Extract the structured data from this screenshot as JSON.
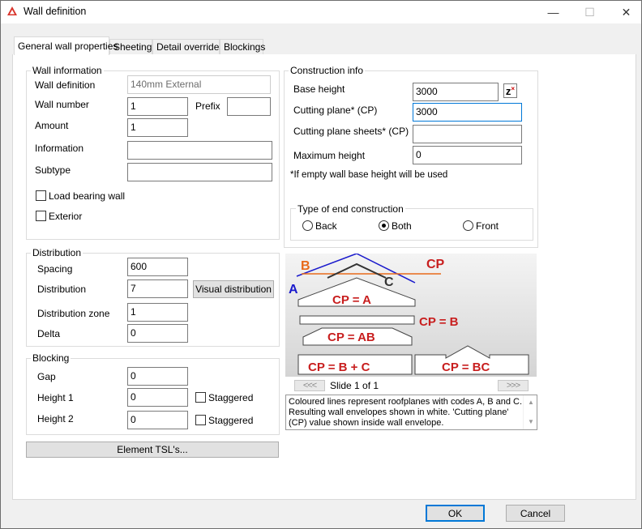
{
  "window": {
    "title": "Wall definition",
    "minimize": "—",
    "maximize": "☐",
    "close": "✕"
  },
  "tabs": [
    {
      "label": "General wall properties"
    },
    {
      "label": "Sheeting"
    },
    {
      "label": "Detail overrides"
    },
    {
      "label": "Blockings"
    }
  ],
  "wall_info": {
    "legend": "Wall information",
    "wall_definition_label": "Wall definition",
    "wall_definition_value": "140mm External",
    "wall_number_label": "Wall number",
    "wall_number_value": "1",
    "prefix_label": "Prefix",
    "prefix_value": "",
    "amount_label": "Amount",
    "amount_value": "1",
    "information_label": "Information",
    "information_value": "",
    "subtype_label": "Subtype",
    "subtype_value": "",
    "load_bearing_label": "Load bearing wall",
    "load_bearing_checked": false,
    "exterior_label": "Exterior",
    "exterior_checked": false
  },
  "distribution": {
    "legend": "Distribution",
    "spacing_label": "Spacing",
    "spacing_value": "600",
    "distribution_label": "Distribution",
    "distribution_value": "7",
    "visual_button": "Visual distribution",
    "zone_label": "Distribution zone",
    "zone_value": "1",
    "delta_label": "Delta",
    "delta_value": "0"
  },
  "blocking": {
    "legend": "Blocking",
    "gap_label": "Gap",
    "gap_value": "0",
    "height1_label": "Height 1",
    "height1_value": "0",
    "height2_label": "Height 2",
    "height2_value": "0",
    "staggered_label": "Staggered",
    "staggered1_checked": false,
    "staggered2_checked": false
  },
  "element_tsl_button": "Element TSL's...",
  "construction": {
    "legend": "Construction info",
    "base_height_label": "Base height",
    "base_height_value": "3000",
    "cutting_plane_label": "Cutting plane* (CP)",
    "cutting_plane_value": "3000",
    "cutting_sheets_label": "Cutting plane sheets* (CP)",
    "cutting_sheets_value": "",
    "max_height_label": "Maximum height",
    "max_height_value": "0",
    "note": "*If empty wall base height will be used",
    "z_icon": "z",
    "z_icon_sup": "×"
  },
  "end_construction": {
    "legend": "Type of end construction",
    "options": [
      "Back",
      "Both",
      "Front"
    ],
    "selected": "Both"
  },
  "slide": {
    "labels": {
      "b": "B",
      "cp": "CP",
      "a": "A",
      "c": "C",
      "cp_a": "CP = A",
      "cp_b": "CP = B",
      "cp_ab": "CP = AB",
      "cp_b_c": "CP = B + C",
      "cp_bc": "CP = BC"
    },
    "colors": {
      "red": "#c81e1e",
      "orange": "#e86a1a",
      "blue": "#1a1acc",
      "dark": "#333333"
    },
    "prev": "<<<",
    "next": ">>>",
    "counter": "Slide 1 of 1",
    "description": "Coloured lines represent roofplanes with codes A, B and C. Resulting wall envelopes shown in white. 'Cutting plane' (CP) value shown inside wall envelope."
  },
  "footer": {
    "ok": "OK",
    "cancel": "Cancel"
  }
}
